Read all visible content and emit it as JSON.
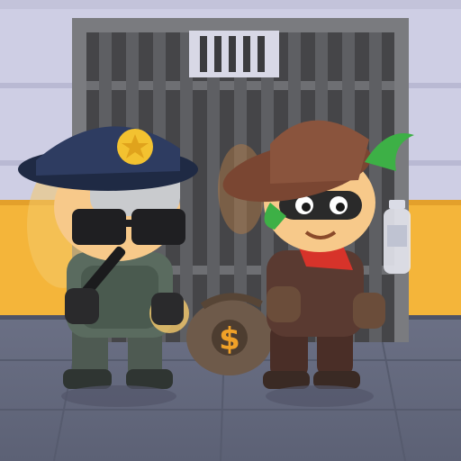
{
  "scene": {
    "colors": {
      "wall_top": "#CECEE4",
      "wall_top_shade": "#B9B9D3",
      "wall_band": "#F4B53A",
      "floor": "#63687D",
      "floor_line": "#4E5366",
      "bars": "#4C4C4F",
      "bars_frame": "#7A7B7F",
      "police_blue": "#2E3C61",
      "badge_gold": "#F3C230",
      "robber_brown": "#7A4632",
      "robber_green": "#3DB046",
      "mask_dark": "#2A2A2A",
      "bandana_red": "#D7332A",
      "money_bag": "#6E5A4A",
      "dollar_orange": "#F0A128"
    },
    "characters": [
      {
        "role": "police-officer",
        "icon": "police-officer-icon"
      },
      {
        "role": "robber",
        "icon": "robber-icon"
      }
    ],
    "props": {
      "money_bag_symbol": "$",
      "bottle_icon": "water-bottle-icon",
      "badge_icon": "star-badge-icon",
      "jail_icon": "jail-bars-icon"
    }
  }
}
